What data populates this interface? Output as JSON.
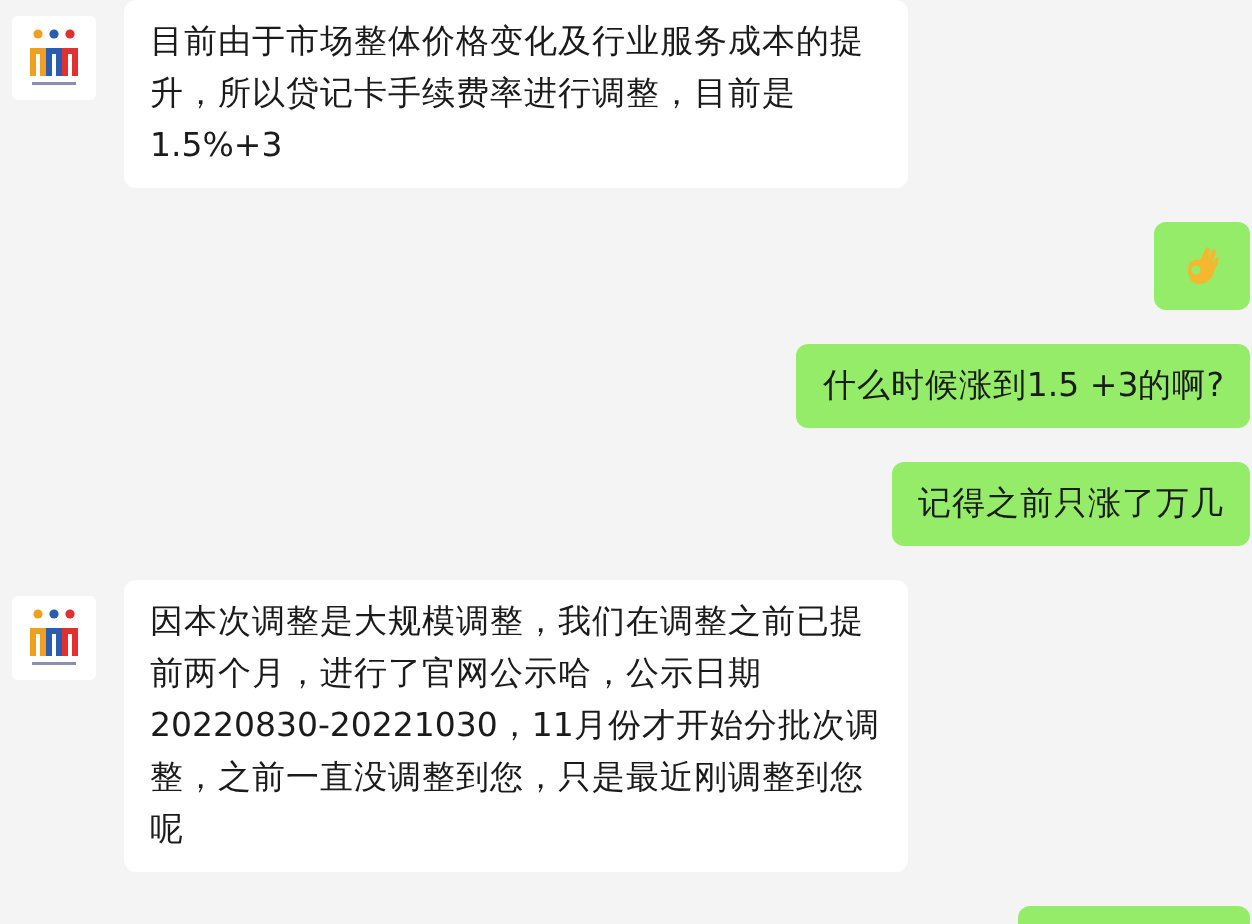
{
  "messages": [
    {
      "sent": false,
      "kind": "text",
      "text": "目前由于市场整体价格变化及行业服务成本的提升，所以贷记卡手续费率进行调整，目前是1.5%+3"
    },
    {
      "sent": true,
      "kind": "ok-hand"
    },
    {
      "sent": true,
      "kind": "text",
      "text": "什么时候涨到1.5 +3的啊?"
    },
    {
      "sent": true,
      "kind": "text",
      "text": "记得之前只涨了万几"
    },
    {
      "sent": false,
      "kind": "text",
      "text": "因本次调整是大规模调整，我们在调整之前已提前两个月，进行了官网公示哈，公示日期20220830-20221030，11月份才开始分批次调整，之前一直没调整到您，只是最近刚调整到您呢"
    },
    {
      "sent": true,
      "kind": "cut-off"
    }
  ]
}
